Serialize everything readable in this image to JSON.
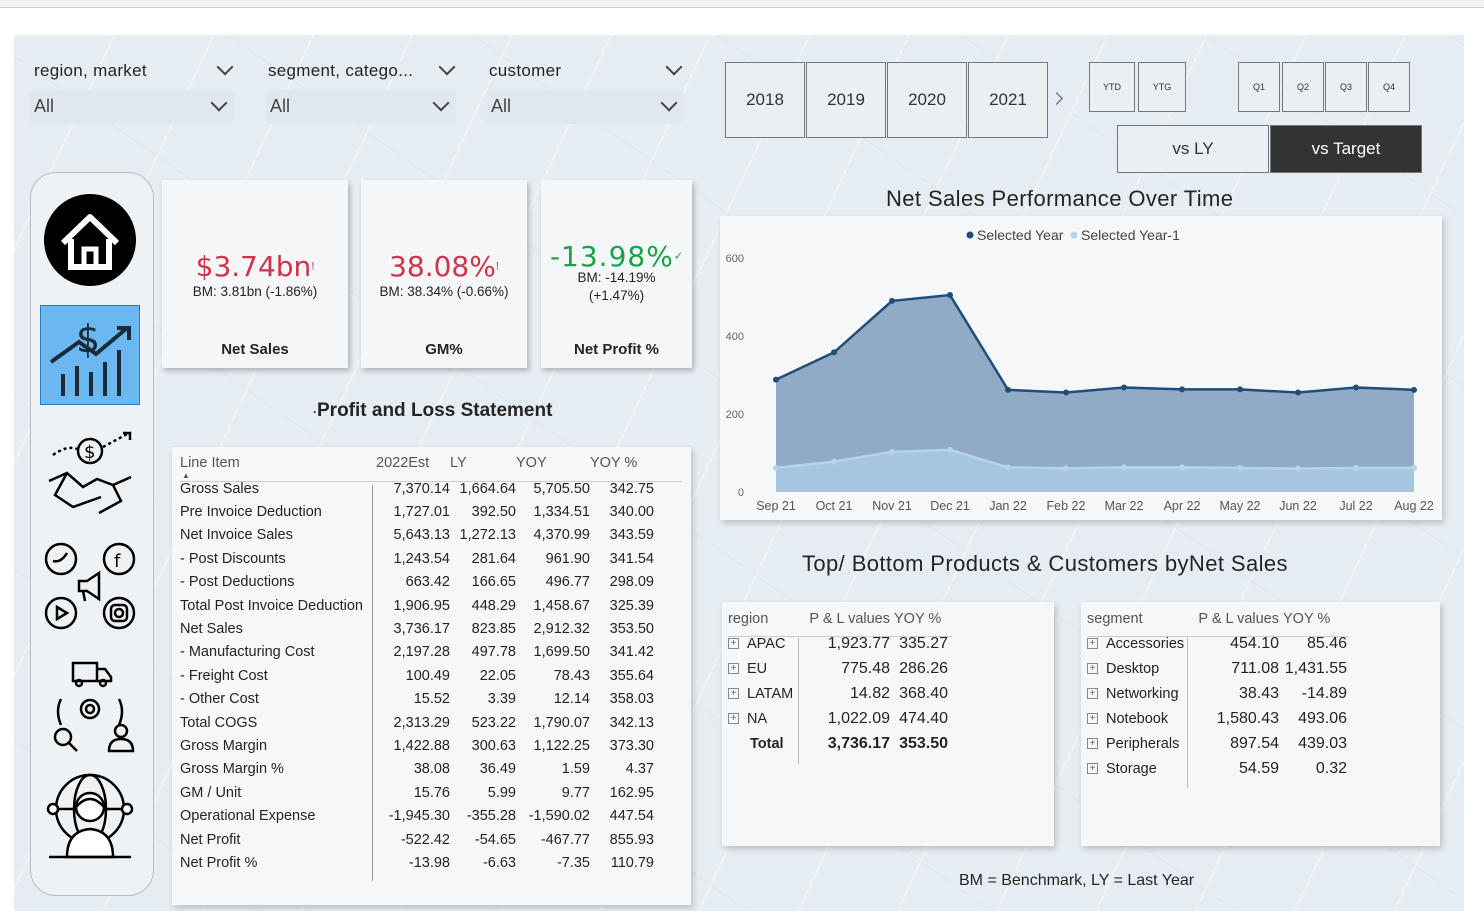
{
  "slicers": [
    {
      "label": "region, market",
      "value": "All"
    },
    {
      "label": "segment, catego...",
      "value": "All"
    },
    {
      "label": "customer",
      "value": "All"
    }
  ],
  "years": [
    "2018",
    "2019",
    "2020",
    "2021"
  ],
  "period_buttons": [
    "YTD",
    "YTG"
  ],
  "quarter_buttons": [
    "Q1",
    "Q2",
    "Q3",
    "Q4"
  ],
  "compare": {
    "vs_ly": "vs LY",
    "vs_target": "vs Target"
  },
  "kpis": [
    {
      "value": "$3.74bn",
      "flag": "!",
      "bm": "BM: 3.81bn (-1.86%)",
      "label": "Net Sales",
      "color": "#d0344a"
    },
    {
      "value": "38.08%",
      "flag": "!",
      "bm": "BM: 38.34% (-0.66%)",
      "label": "GM%",
      "color": "#d0344a"
    },
    {
      "value": "-13.98%",
      "flag": "✓",
      "bm": "BM: -14.19%",
      "bm2": "(+1.47%)",
      "label": "Net Profit %",
      "color": "#1aa34a"
    }
  ],
  "pl": {
    "title": "Profit  and Loss Statement",
    "headers": [
      "Line Item",
      "2022Est",
      "LY",
      "YOY",
      "YOY %"
    ],
    "rows": [
      [
        "Gross Sales",
        "7,370.14",
        "1,664.64",
        "5,705.50",
        "342.75"
      ],
      [
        "Pre Invoice Deduction",
        "1,727.01",
        "392.50",
        "1,334.51",
        "340.00"
      ],
      [
        "Net Invoice Sales",
        "5,643.13",
        "1,272.13",
        "4,370.99",
        "343.59"
      ],
      [
        "- Post Discounts",
        "1,243.54",
        "281.64",
        "961.90",
        "341.54"
      ],
      [
        "- Post Deductions",
        "663.42",
        "166.65",
        "496.77",
        "298.09"
      ],
      [
        "Total Post Invoice Deduction",
        "1,906.95",
        "448.29",
        "1,458.67",
        "325.39"
      ],
      [
        "Net Sales",
        "3,736.17",
        "823.85",
        "2,912.32",
        "353.50"
      ],
      [
        "- Manufacturing Cost",
        "2,197.28",
        "497.78",
        "1,699.50",
        "341.42"
      ],
      [
        "- Freight Cost",
        "100.49",
        "22.05",
        "78.43",
        "355.64"
      ],
      [
        "- Other Cost",
        "15.52",
        "3.39",
        "12.14",
        "358.03"
      ],
      [
        "Total COGS",
        "2,313.29",
        "523.22",
        "1,790.07",
        "342.13"
      ],
      [
        "Gross Margin",
        "1,422.88",
        "300.63",
        "1,122.25",
        "373.30"
      ],
      [
        "Gross Margin %",
        "38.08",
        "36.49",
        "1.59",
        "4.37"
      ],
      [
        "GM / Unit",
        "15.76",
        "5.99",
        "9.77",
        "162.95"
      ],
      [
        "Operational Expense",
        "-1,945.30",
        "-355.28",
        "-1,590.02",
        "447.54"
      ],
      [
        "Net Profit",
        "-522.42",
        "-54.65",
        "-467.77",
        "855.93"
      ],
      [
        "Net Profit %",
        "-13.98",
        "-6.63",
        "-7.35",
        "110.79"
      ]
    ]
  },
  "chart_title": "Net Sales Performance Over Time",
  "chart_data": {
    "type": "area",
    "categories": [
      "Sep 21",
      "Oct 21",
      "Nov 21",
      "Dec 21",
      "Jan 22",
      "Feb 22",
      "Mar 22",
      "Apr 22",
      "May 22",
      "Jun 22",
      "Jul 22",
      "Aug 22"
    ],
    "series": [
      {
        "name": "Selected Year",
        "values": [
          288,
          358,
          490,
          505,
          262,
          255,
          268,
          263,
          263,
          255,
          268,
          262
        ],
        "color": "#1f4e79"
      },
      {
        "name": "Selected Year-1",
        "values": [
          62,
          78,
          103,
          108,
          63,
          61,
          63,
          63,
          62,
          60,
          62,
          62
        ],
        "color": "#b7d3ea"
      }
    ],
    "ylim": [
      0,
      600
    ],
    "yticks": [
      "0",
      "200",
      "400",
      "600"
    ],
    "legend": "top"
  },
  "top_title": "Top/ Bottom Products & Customers byNet Sales",
  "region_table": {
    "headers": [
      "region",
      "P & L values",
      "YOY %"
    ],
    "rows": [
      [
        "APAC",
        "1,923.77",
        "335.27"
      ],
      [
        "EU",
        "775.48",
        "286.26"
      ],
      [
        "LATAM",
        "14.82",
        "368.40"
      ],
      [
        "NA",
        "1,022.09",
        "474.40"
      ]
    ],
    "total": [
      "Total",
      "3,736.17",
      "353.50"
    ]
  },
  "segment_table": {
    "headers": [
      "segment",
      "P & L values",
      "YOY %"
    ],
    "rows": [
      [
        "Accessories",
        "454.10",
        "85.46"
      ],
      [
        "Desktop",
        "711.08",
        "1,431.55"
      ],
      [
        "Networking",
        "38.43",
        "-14.89"
      ],
      [
        "Notebook",
        "1,580.43",
        "493.06"
      ],
      [
        "Peripherals",
        "897.54",
        "439.03"
      ],
      [
        "Storage",
        "54.59",
        "0.32"
      ]
    ]
  },
  "footnote": "BM = Benchmark, LY = Last Year",
  "nav_icons": [
    "home-icon",
    "finance-growth-icon",
    "deal-handshake-icon",
    "social-media-icon",
    "supply-chain-icon",
    "global-support-icon"
  ]
}
